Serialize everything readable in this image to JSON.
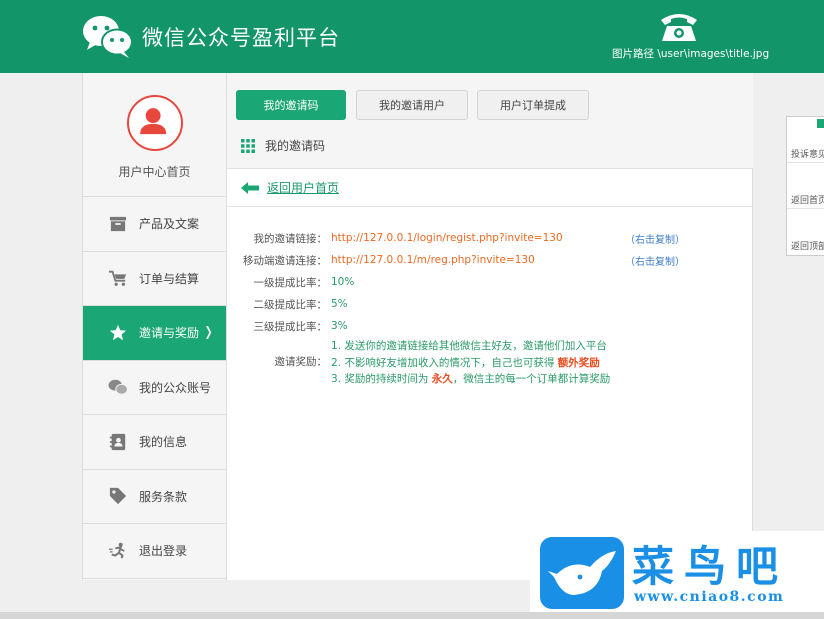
{
  "header": {
    "title": "微信公众号盈利平台",
    "image_path": "图片路径 \\user\\images\\title.jpg"
  },
  "sidebar": {
    "user_center": "用户中心首页",
    "items": [
      {
        "label": "产品及文案",
        "icon": "archive-icon"
      },
      {
        "label": "订单与结算",
        "icon": "cart-icon"
      },
      {
        "label": "邀请与奖励",
        "icon": "star-icon",
        "active": true
      },
      {
        "label": "我的公众账号",
        "icon": "wechat-icon"
      },
      {
        "label": "我的信息",
        "icon": "contact-card-icon"
      },
      {
        "label": "服务条款",
        "icon": "tag-icon"
      },
      {
        "label": "退出登录",
        "icon": "runner-icon"
      }
    ],
    "active_chevron": "❭"
  },
  "tabs": [
    {
      "label": "我的邀请码",
      "active": true
    },
    {
      "label": "我的邀请用户",
      "active": false
    },
    {
      "label": "用户订单提成",
      "active": false
    }
  ],
  "section_title": "我的邀请码",
  "back_link": "返回用户首页",
  "form": {
    "invite_link_label": "我的邀请链接：",
    "invite_link": "http://127.0.0.1/login/regist.php?invite=130",
    "mobile_link_label": "移动端邀请连接：",
    "mobile_link": "http://127.0.0.1/m/reg.php?invite=130",
    "copy_label": "（右击复制）",
    "level1_label": "一级提成比率：",
    "level1_value": "10%",
    "level2_label": "二级提成比率：",
    "level2_value": "5%",
    "level3_label": "三级提成比率：",
    "level3_value": "3%",
    "reward_label": "邀请奖励：",
    "reward_line1": "1. 发送你的邀请链接给其他微信主好友，邀请他们加入平台",
    "reward_line2_prefix": "2. 不影响好友增加收入的情况下，自己也可获得",
    "reward_line2_highlight": "额外奖励",
    "reward_line3_prefix": "3. 奖励的持续时间为",
    "reward_line3_highlight": "永久",
    "reward_line3_suffix": "，微信主的每一个订单都计算奖励"
  },
  "float_panel": {
    "items": [
      "投诉意见",
      "返回首页",
      "返回顶部"
    ]
  },
  "watermark": {
    "brand": "菜鸟吧",
    "url": "www.cniao8.com"
  },
  "colors": {
    "brand_green": "#13956a",
    "active_green": "#1ba775",
    "link_orange": "#ea6a23",
    "copy_blue": "#3d7cc9",
    "avatar_red": "#e8473e"
  }
}
